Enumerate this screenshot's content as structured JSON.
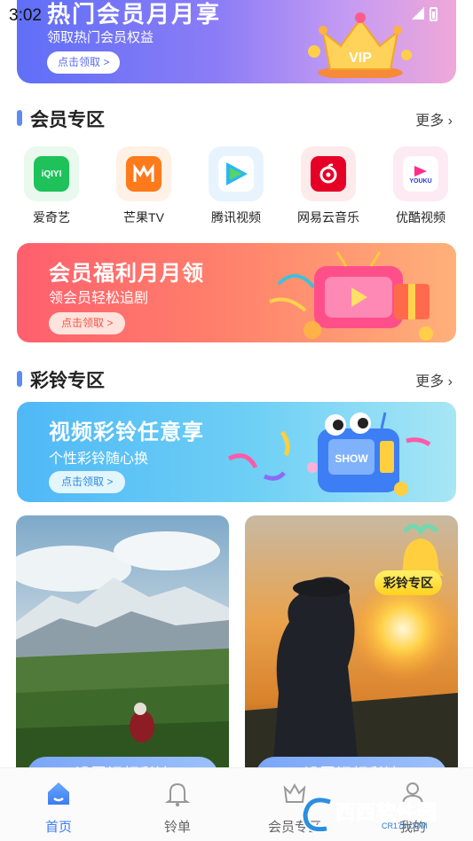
{
  "status_bar": {
    "time": "3:02"
  },
  "top_banner": {
    "title": "热门会员月月享",
    "subtitle": "领取热门会员权益",
    "cta": "点击领取 >",
    "badge": "VIP"
  },
  "member_section": {
    "title": "会员专区",
    "more": "更多"
  },
  "apps": [
    {
      "name": "爱奇艺",
      "logo_text": "iQIYI"
    },
    {
      "name": "芒果TV",
      "logo_text": ""
    },
    {
      "name": "腾讯视频",
      "logo_text": ""
    },
    {
      "name": "网易云音乐",
      "logo_text": ""
    },
    {
      "name": "优酷视频",
      "logo_text": "YOUKU"
    }
  ],
  "benefit_banner": {
    "title": "会员福利月月领",
    "subtitle": "领会员轻松追剧",
    "cta": "点击领取 >"
  },
  "ringtone_section": {
    "title": "彩铃专区",
    "more": "更多"
  },
  "video_banner": {
    "title": "视频彩铃任意享",
    "subtitle": "个性彩铃随心换",
    "cta": "点击领取 >",
    "robot_text": "SHOW"
  },
  "cards": [
    {
      "button": "设置视频彩铃"
    },
    {
      "button": "设置视频彩铃",
      "tag": "彩铃专区"
    }
  ],
  "tabbar": [
    {
      "label": "首页",
      "icon": "home-icon",
      "active": true
    },
    {
      "label": "铃单",
      "icon": "bell-icon",
      "active": false
    },
    {
      "label": "会员专区",
      "icon": "crown-icon",
      "active": false
    },
    {
      "label": "我的",
      "icon": "user-icon",
      "active": false
    }
  ],
  "watermark": {
    "text": "西西软件园",
    "sub": "CR173.COM"
  },
  "colors": {
    "accent": "#3b7cf3",
    "section_bar": "#5b8cf5"
  }
}
